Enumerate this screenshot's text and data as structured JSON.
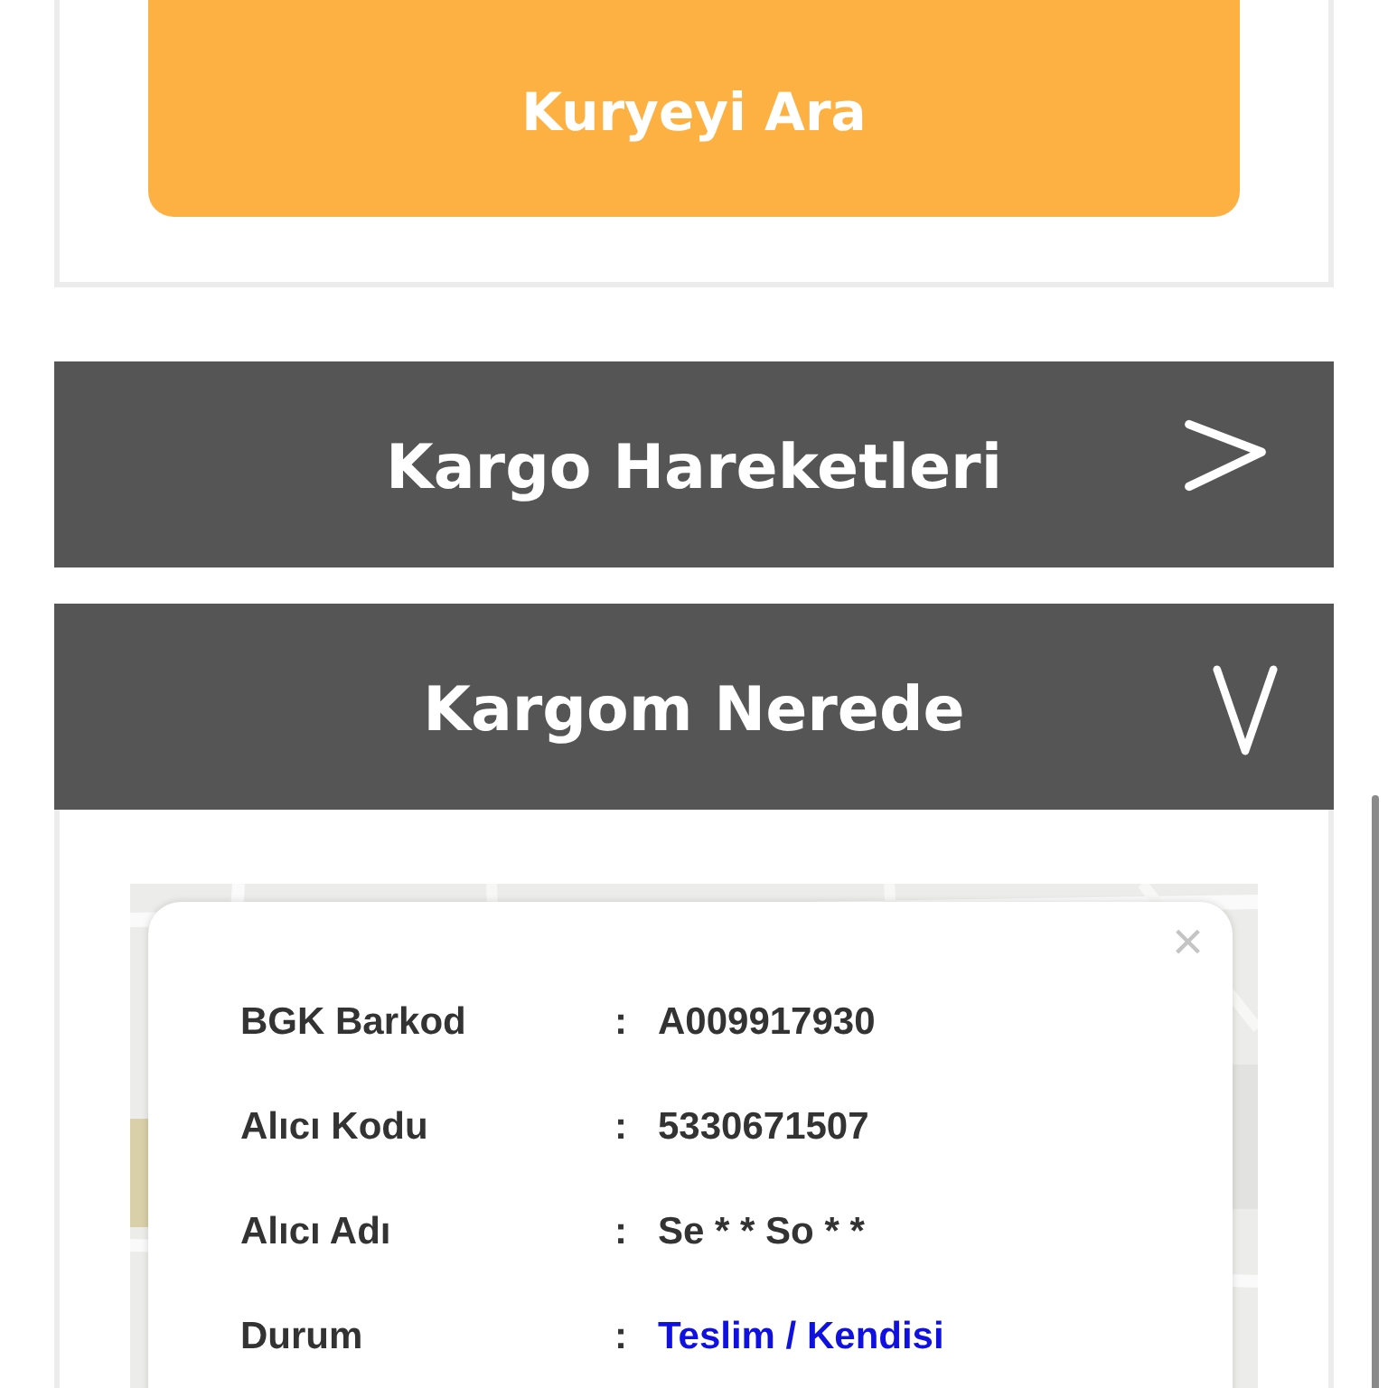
{
  "call_button": {
    "label": "Kuryeyi Ara"
  },
  "sections": [
    {
      "title": "Kargo Hareketleri",
      "expanded": false
    },
    {
      "title": "Kargom Nerede",
      "expanded": true
    }
  ],
  "info_popup": {
    "close": "×",
    "rows": [
      {
        "label": "BGK Barkod",
        "separator": ":",
        "value": "A009917930",
        "kind": "plain"
      },
      {
        "label": "Alıcı Kodu",
        "separator": ":",
        "value": "5330671507",
        "kind": "plain"
      },
      {
        "label": "Alıcı Adı",
        "separator": ":",
        "value": "Se * * So * *",
        "kind": "plain"
      },
      {
        "label": "Durum",
        "separator": ":",
        "value": "Teslim / Kendisi",
        "kind": "status"
      }
    ]
  }
}
